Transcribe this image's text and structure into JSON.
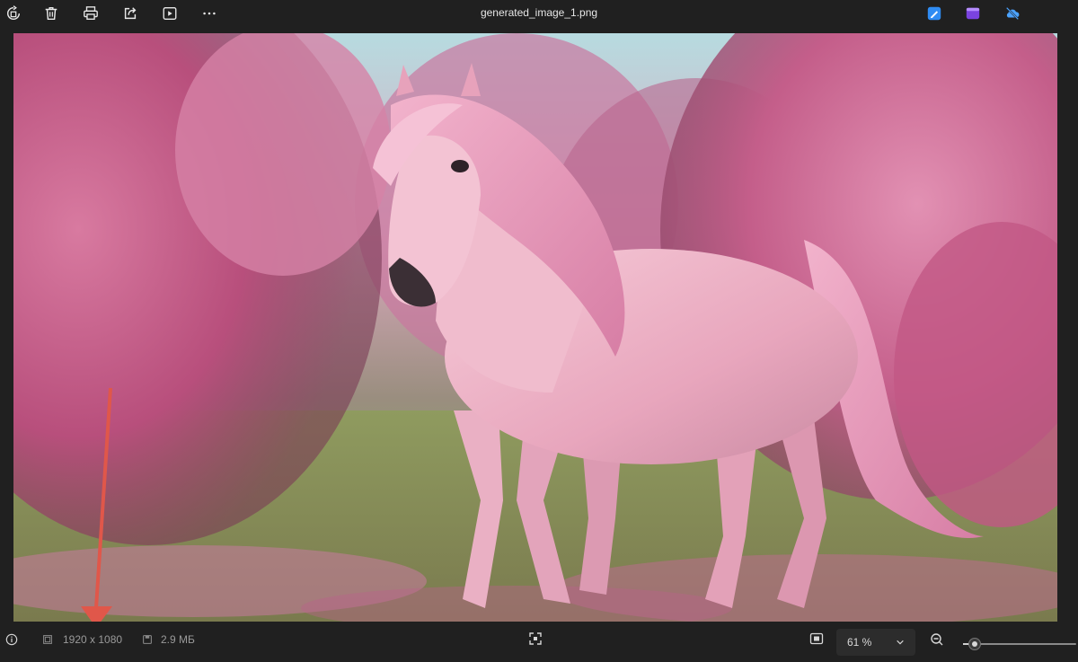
{
  "window": {
    "title": "generated_image_1.png"
  },
  "toolbar": {
    "left_buttons": [
      {
        "name": "rotate-button",
        "icon": "rotate-icon"
      },
      {
        "name": "delete-button",
        "icon": "trash-icon"
      },
      {
        "name": "print-button",
        "icon": "printer-icon"
      },
      {
        "name": "share-button",
        "icon": "share-icon"
      },
      {
        "name": "slideshow-button",
        "icon": "play-icon"
      },
      {
        "name": "more-button",
        "icon": "more-icon"
      }
    ],
    "right_buttons": [
      {
        "name": "edit-app-button",
        "icon": "edit-app-icon",
        "color": "#2f8cf3"
      },
      {
        "name": "clipchamp-button",
        "icon": "video-editor-icon",
        "color": "#7a43e0"
      },
      {
        "name": "onedrive-button",
        "icon": "cloud-offline-icon",
        "color": "#4ba3ff"
      }
    ]
  },
  "image": {
    "description_icon": "pink-horse-artwork"
  },
  "annotation": {
    "arrow_color": "#e0574a"
  },
  "status": {
    "dimensions": "1920 x 1080",
    "file_size": "2.9 МБ",
    "zoom_value": "61 %",
    "zoom_level_fraction": 0.1
  }
}
